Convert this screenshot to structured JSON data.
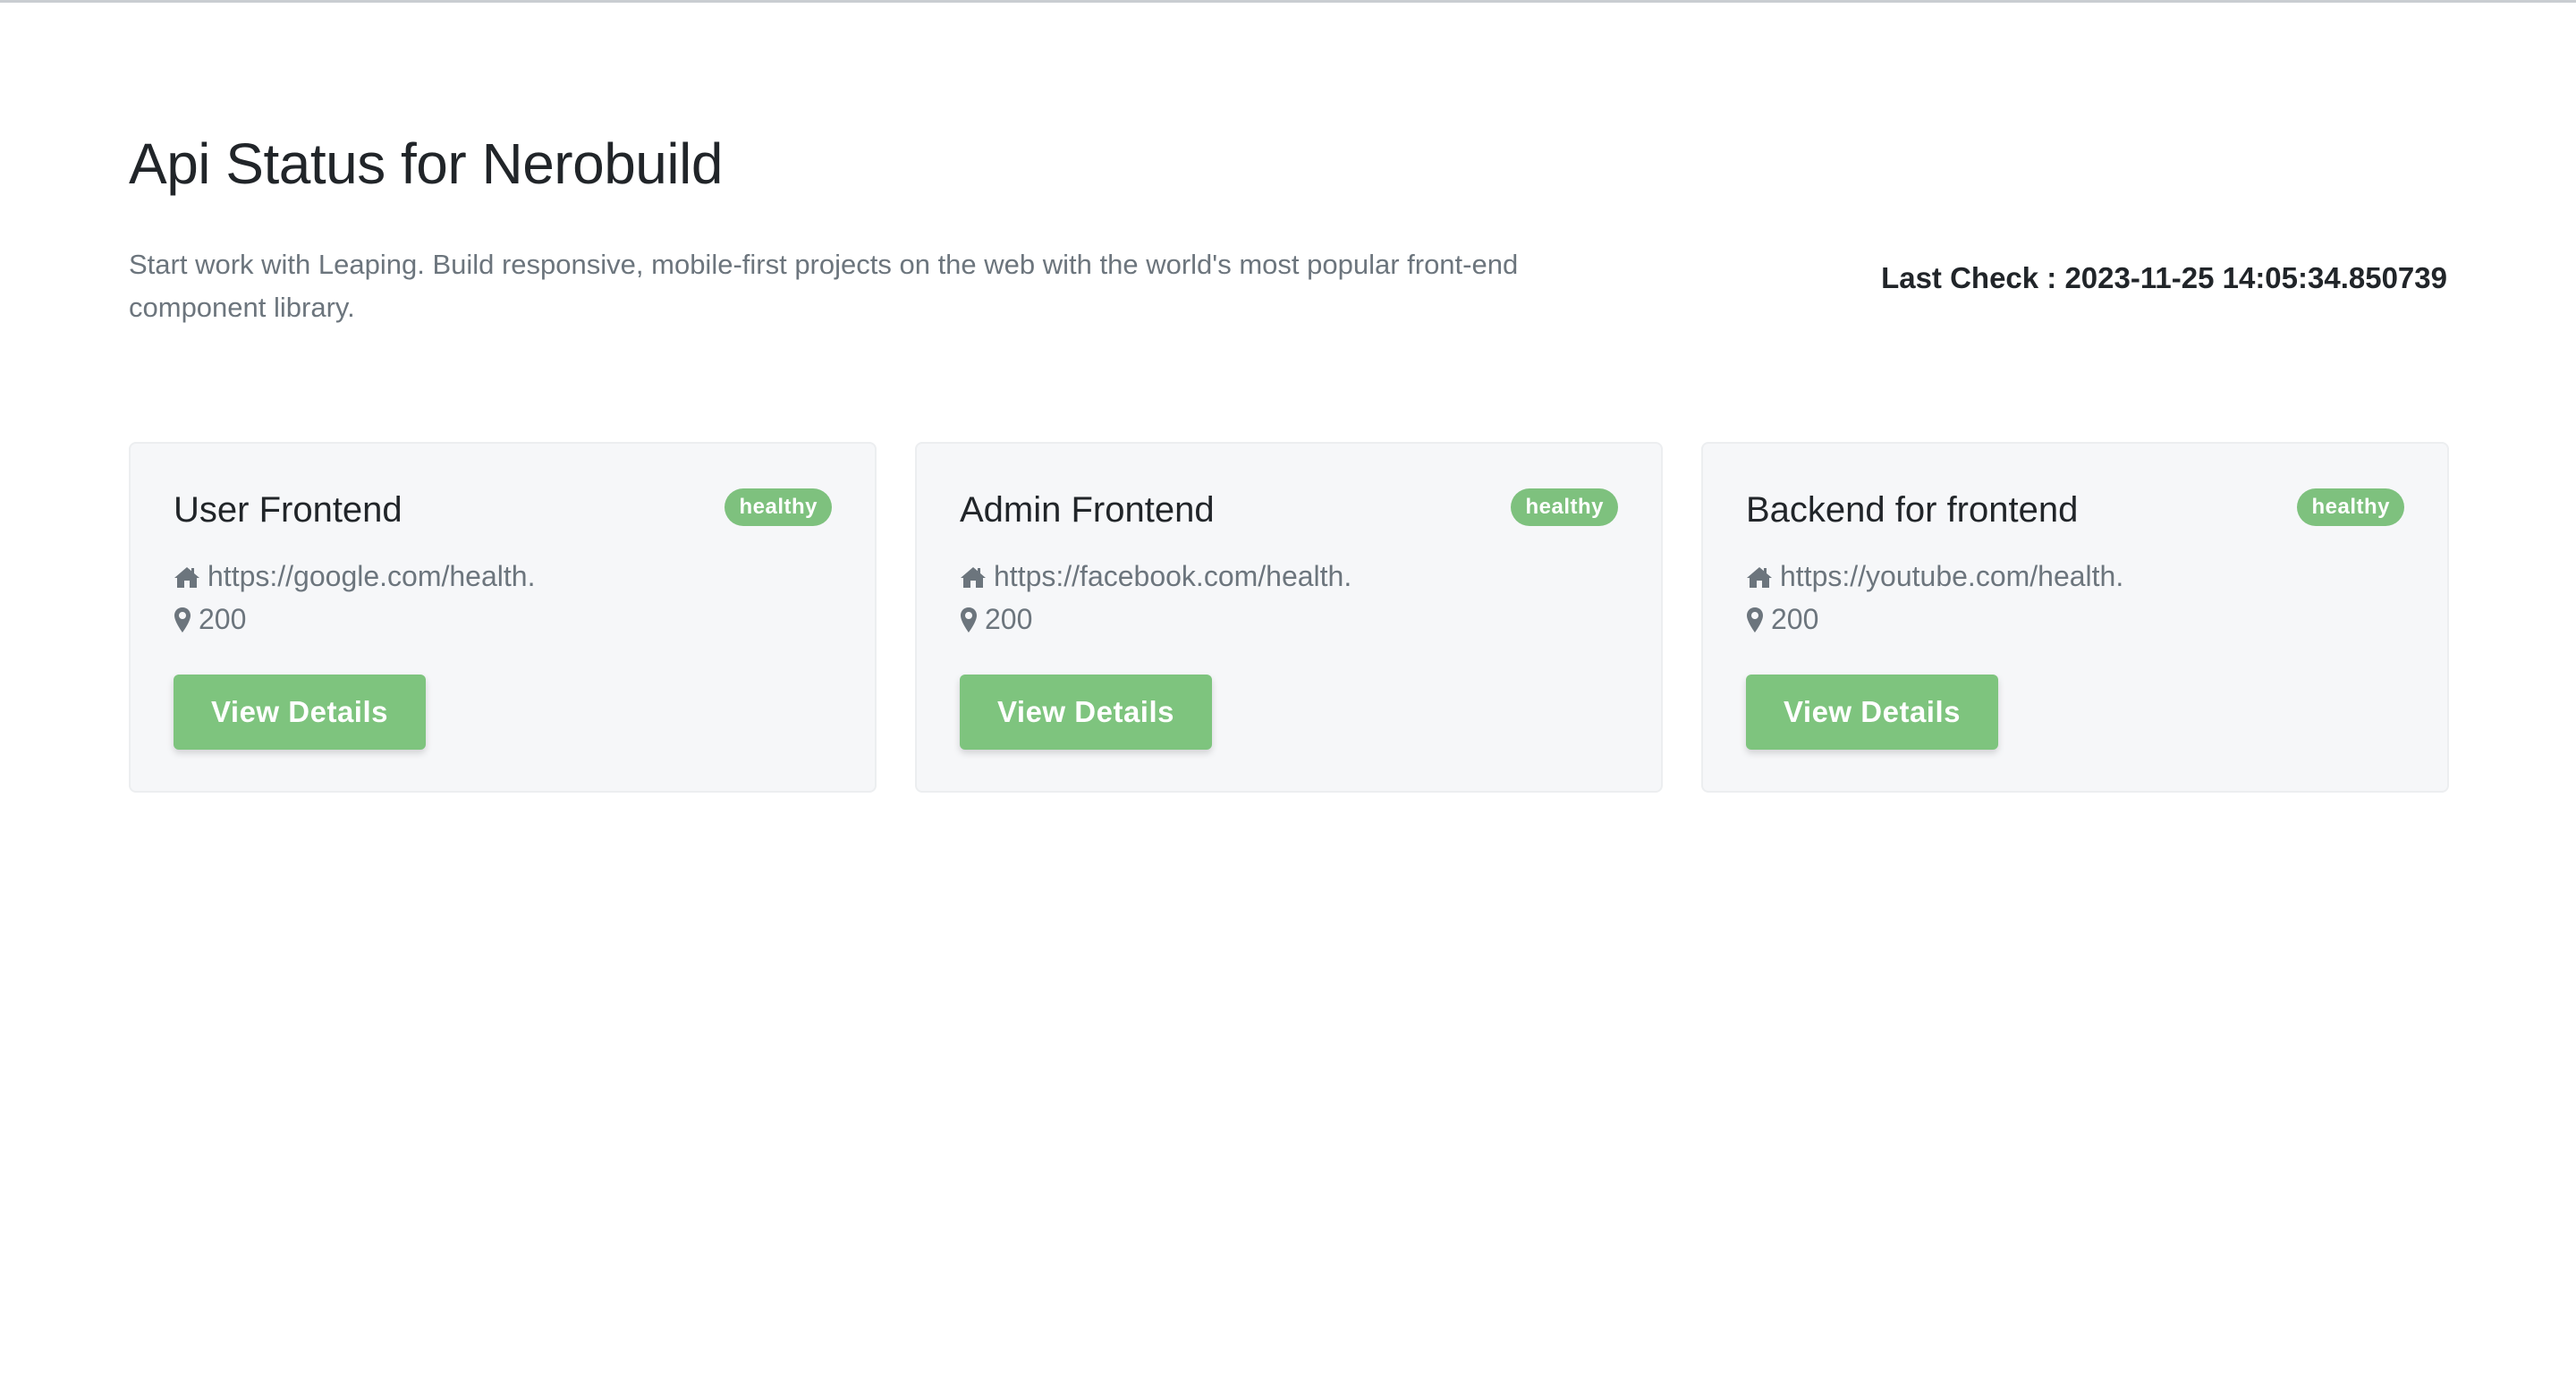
{
  "page": {
    "title": "Api Status for Nerobuild",
    "description": "Start work with Leaping. Build responsive, mobile-first projects on the web with the world's most popular front-end component library.",
    "last_check": "Last Check : 2023-11-25 14:05:34.850739"
  },
  "colors": {
    "healthy": "#7ec17e",
    "button": "#7ec47e",
    "card_background": "#f6f7f9",
    "muted_text": "#6c757d"
  },
  "services": [
    {
      "name": "User Frontend",
      "status": "healthy",
      "url_icon": "home-icon",
      "url": "https://google.com/health.",
      "code_icon": "map-marker-icon",
      "code": "200",
      "button": "View Details"
    },
    {
      "name": "Admin Frontend",
      "status": "healthy",
      "url_icon": "home-icon",
      "url": "https://facebook.com/health.",
      "code_icon": "map-marker-icon",
      "code": "200",
      "button": "View Details"
    },
    {
      "name": "Backend for frontend",
      "status": "healthy",
      "url_icon": "home-icon",
      "url": "https://youtube.com/health.",
      "code_icon": "map-marker-icon",
      "code": "200",
      "button": "View Details"
    }
  ]
}
